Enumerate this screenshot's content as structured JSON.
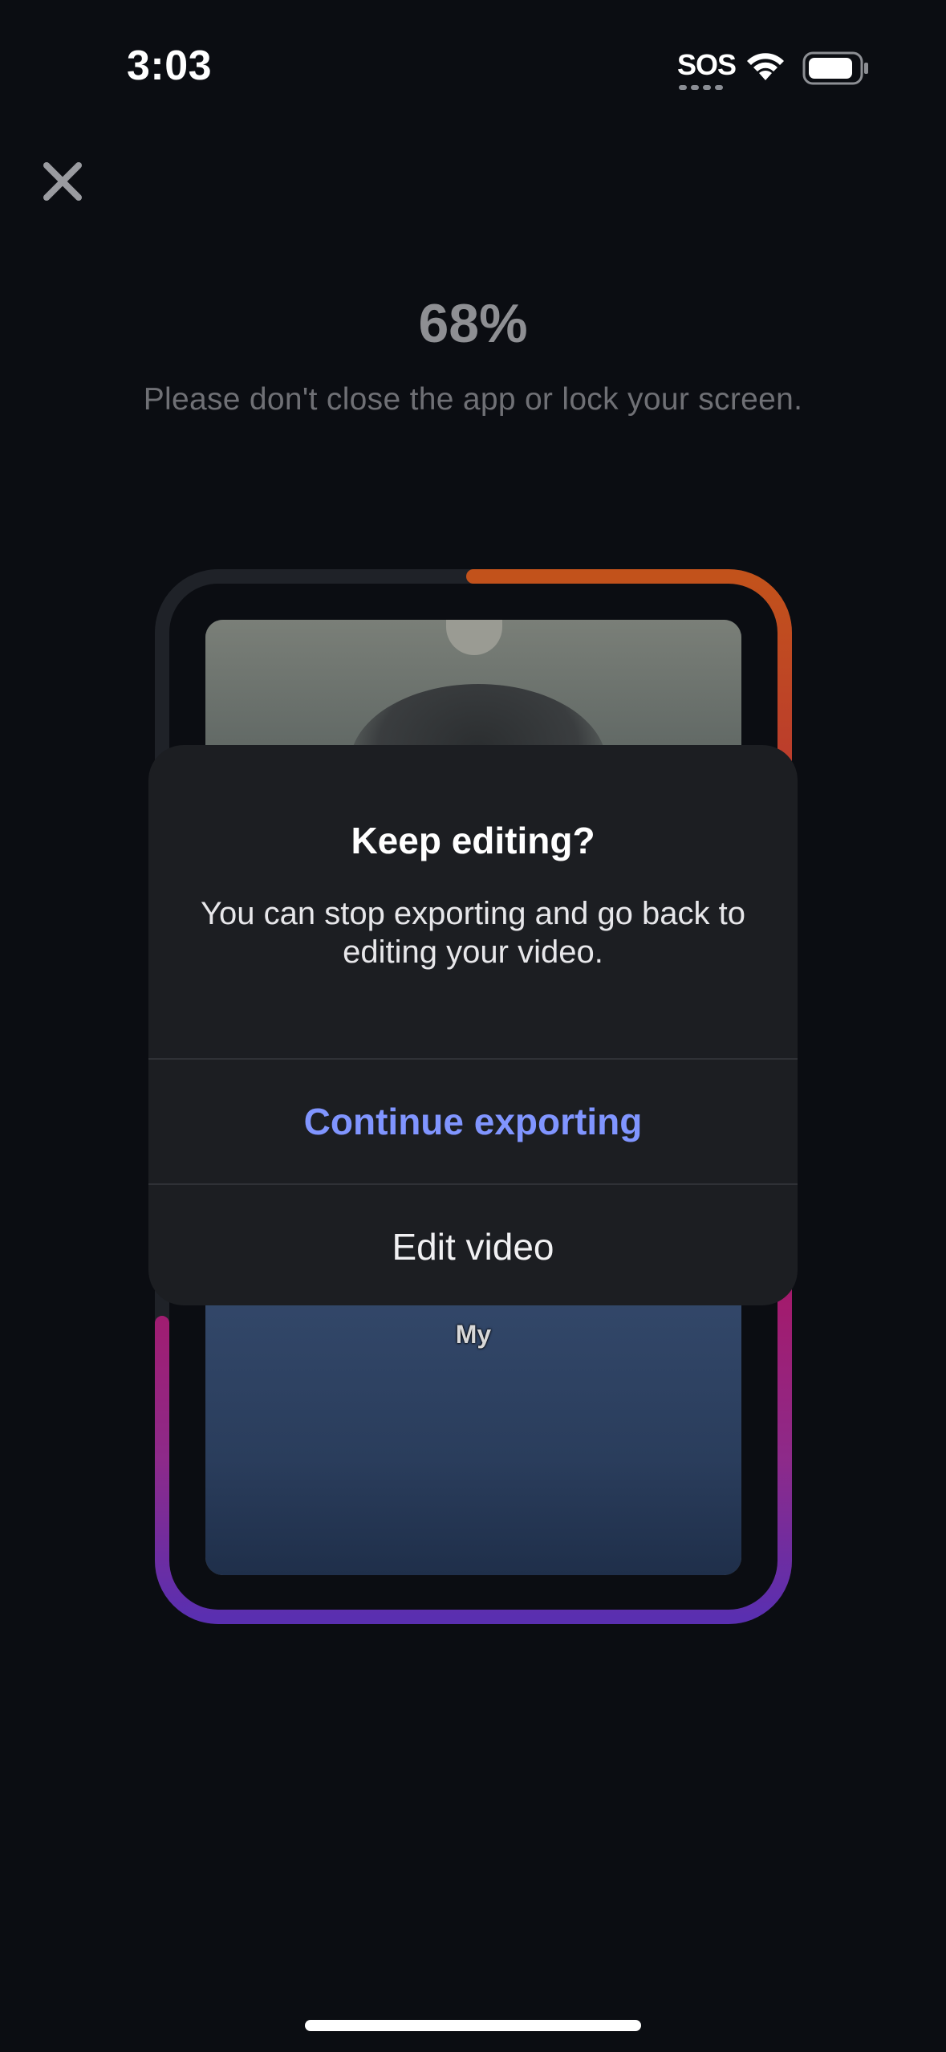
{
  "status_bar": {
    "time": "3:03",
    "sos_label": "SOS",
    "wifi_icon": "wifi-icon",
    "battery_icon": "battery-icon"
  },
  "export": {
    "close_icon": "close-icon",
    "percent": "68%",
    "progress": 0.68,
    "notice": "Please don't close the app or lock your screen.",
    "progress_colors": {
      "track": "#1f2228",
      "orange": "#c0531c",
      "pink": "#b0125c",
      "purple": "#5a2fb0"
    }
  },
  "preview": {
    "caption": "My"
  },
  "dialog": {
    "title": "Keep editing?",
    "body": "You can stop exporting and go back to editing your video.",
    "primary_button": "Continue exporting",
    "secondary_button": "Edit video",
    "primary_color": "#8095ff"
  }
}
